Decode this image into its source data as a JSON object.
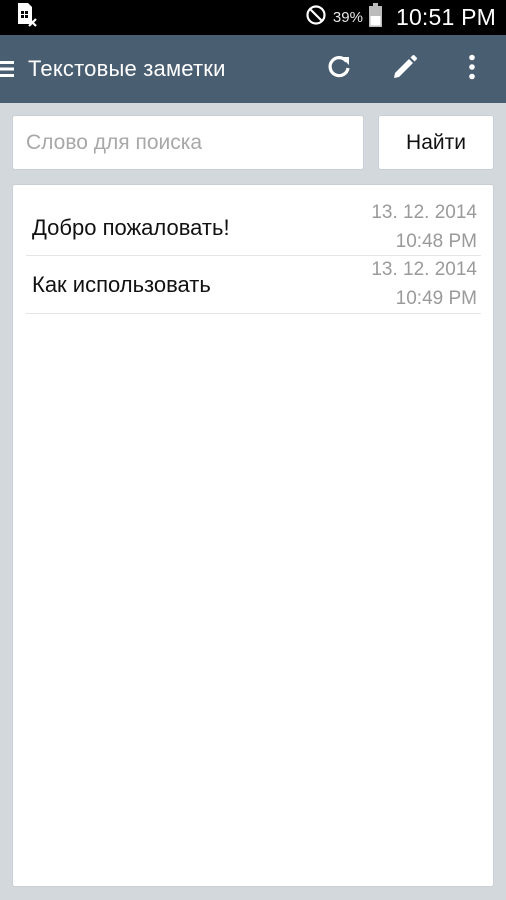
{
  "status_bar": {
    "notification_icon": "sim-card-no-service-icon",
    "dnd_icon": "do-not-disturb-icon",
    "battery_percent": "39%",
    "battery_icon": "battery-icon",
    "time": "10:51 PM"
  },
  "app_bar": {
    "menu_icon": "hamburger-menu-icon",
    "title": "Текстовые заметки",
    "refresh_icon": "refresh-icon",
    "edit_icon": "pencil-icon",
    "overflow_icon": "more-vert-icon"
  },
  "search": {
    "placeholder": "Слово для поиска",
    "value": "",
    "button_label": "Найти"
  },
  "notes": [
    {
      "title": "Добро пожаловать!",
      "date": "13. 12. 2014",
      "time": "10:48 PM"
    },
    {
      "title": "Как использовать",
      "date": "13. 12. 2014",
      "time": "10:49 PM"
    }
  ],
  "colors": {
    "app_bar": "#4a5e72",
    "background": "#d3d8dc",
    "status_bar": "#000000"
  }
}
